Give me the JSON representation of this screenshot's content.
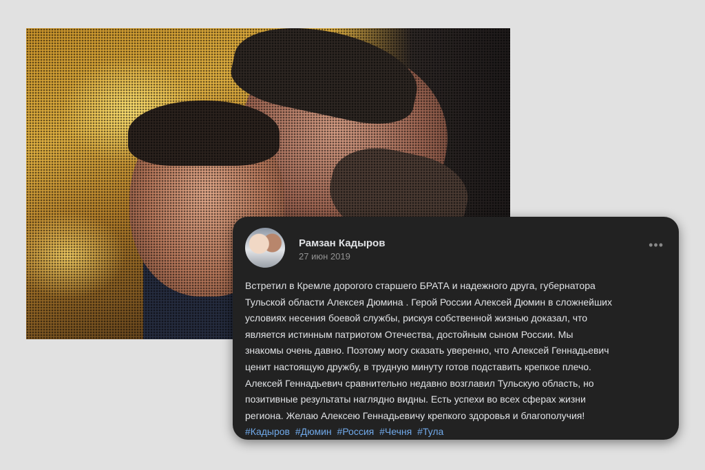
{
  "post": {
    "author": "Рамзан Кадыров",
    "date": "27 июн 2019",
    "more_icon": "more-horizontal-icon",
    "lines": [
      "Встретил в Кремле дорогого старшего БРАТА и надежного друга, губернатора",
      "Тульской области Алексея Дюмина . Герой России Алексей Дюмин в сложнейших",
      "условиях несения боевой службы, рискуя собственной жизнью доказал, что",
      "является истинным патриотом Отечества, достойным сыном России. Мы",
      "знакомы очень давно. Поэтому могу сказать уверенно, что Алексей Геннадьевич",
      "ценит настоящую дружбу, в трудную минуту готов подставить крепкое плечо.",
      "Алексей Геннадьевич сравнительно недавно возглавил Тульскую область, но",
      "позитивные результаты наглядно видны. Есть успехи во всех сферах жизни",
      "региона. Желаю Алексею Геннадьевичу крепкого здоровья и благополучия!"
    ],
    "hashtags": [
      "#Кадыров",
      "#Дюмин",
      "#Россия",
      "#Чечня",
      "#Тула"
    ]
  },
  "colors": {
    "background": "#e1e1e1",
    "card": "#222222",
    "link": "#71aaeb"
  }
}
